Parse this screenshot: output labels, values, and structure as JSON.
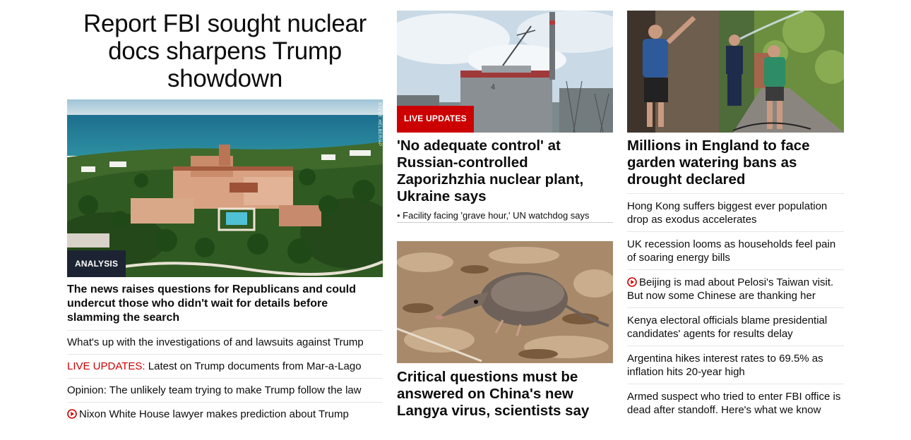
{
  "top_story": {
    "headline": "Report FBI sought nuclear docs sharpens Trump showdown",
    "badge": "ANALYSIS",
    "photo_credit": "STEVE HELBER/AP",
    "lede": "The news raises questions for Republicans and could undercut those who didn't wait for details before slamming the search",
    "related": [
      {
        "text": "What's up with the investigations of and lawsuits against Trump"
      },
      {
        "live_label": "LIVE UPDATES:",
        "text": " Latest on Trump documents from Mar-a-Lago"
      },
      {
        "text": "Opinion: The unlikely team trying to make Trump follow the law"
      },
      {
        "video": true,
        "text": "Nixon White House lawyer makes prediction about Trump"
      }
    ]
  },
  "middle": {
    "story1": {
      "badge": "LIVE UPDATES",
      "headline": "'No adequate control' at Russian-controlled Zaporizhzhia nuclear plant, Ukraine says",
      "sub": "• Facility facing 'grave hour,' UN watchdog says"
    },
    "story2": {
      "headline": "Critical questions must be answered on China's new Langya virus, scientists say"
    }
  },
  "right": {
    "headline": "Millions in England to face garden watering bans as drought declared",
    "items": [
      {
        "text": "Hong Kong suffers biggest ever population drop as exodus accelerates"
      },
      {
        "text": "UK recession looms as households feel pain of soaring energy bills"
      },
      {
        "video": true,
        "text": "Beijing is mad about Pelosi's Taiwan visit. But now some Chinese are thanking her"
      },
      {
        "text": "Kenya electoral officials blame presidential candidates' agents for results delay"
      },
      {
        "text": "Argentina hikes interest rates to 69.5% as inflation hits 20-year high"
      },
      {
        "text": "Armed suspect who tried to enter FBI office is dead after standoff. Here's what we know"
      }
    ]
  },
  "colors": {
    "live_red": "#cc0000",
    "badge_dark": "#1c2333"
  },
  "icons": {
    "video": "play-circle-icon"
  }
}
